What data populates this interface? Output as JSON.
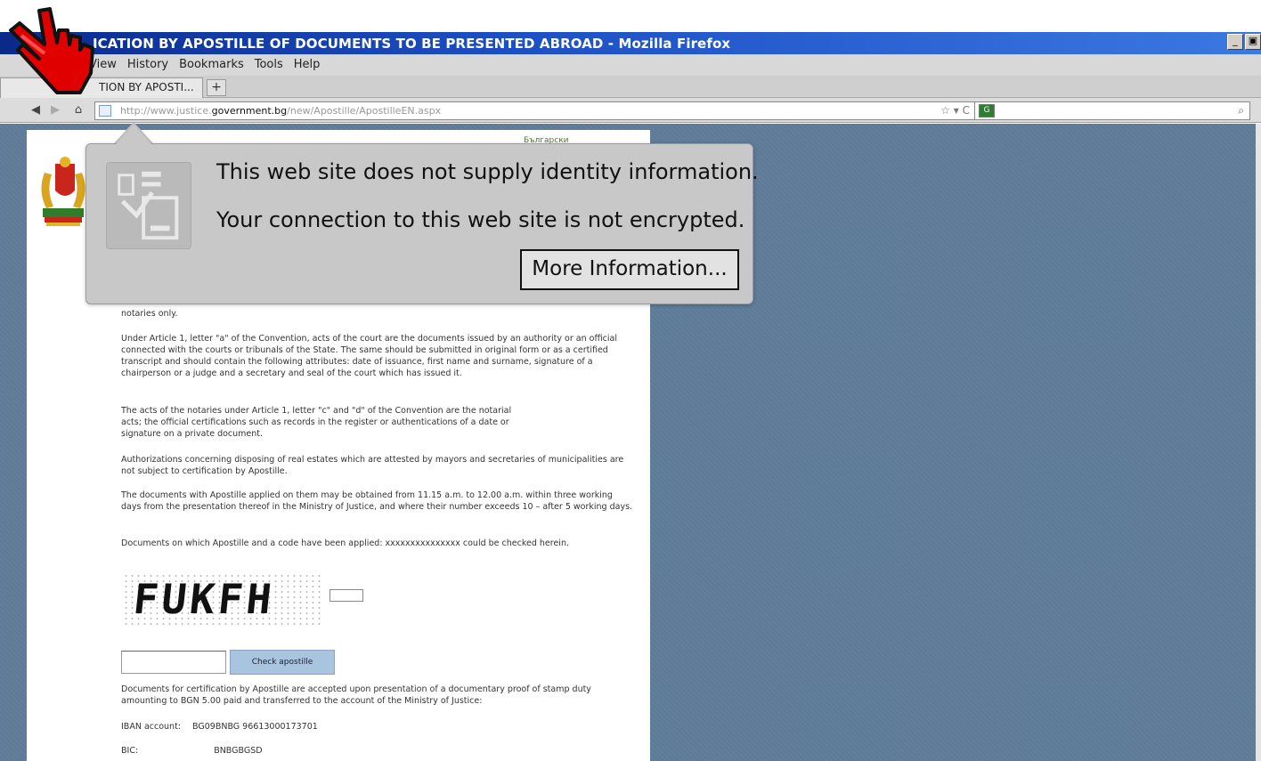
{
  "window": {
    "title": "ICATION BY APOSTILLE OF DOCUMENTS TO BE PRESENTED ABROAD - Mozilla Firefox",
    "minimize": "_",
    "restore": "▣"
  },
  "menubar": {
    "items": [
      "View",
      "History",
      "Bookmarks",
      "Tools",
      "Help"
    ]
  },
  "tabs": [
    {
      "label": "TION BY APOSTI..."
    }
  ],
  "newtab_label": "+",
  "navbar": {
    "url_prefix": "http://www.justice.",
    "url_domain": "government.bg",
    "url_suffix": "/new/Apostille/ApostilleEN.aspx",
    "url_right": "☆ ▾ C"
  },
  "page": {
    "lang_link": "Български",
    "para0": "notaries only.",
    "para1": "Under Article 1, letter \"a\" of the Convention, acts of the court are the documents issued by an authority or an official connected with the courts or tribunals of the State. The same should be submitted in original form or as a certified transcript and should contain the following attributes: date of issuance, first name and surname, signature of a chairperson or a judge and a secretary and seal of the court which has issued it.",
    "para2": "The acts of the notaries under Article 1, letter \"c\" and \"d\" of the Convention are the notarial acts; the official certifications such as records in the register or authentications of a date or signature on a private document.",
    "para3": "Authorizations concerning disposing of real estates which are attested by mayors and secretaries of municipalities are not subject to certification by Apostille.",
    "para4": "The documents with Apostille applied on them may be obtained from 11.15 a.m. to 12.00 a.m. within three working days from the presentation thereof in the Ministry of Justice, and where their number exceeds 10 – after 5 working days.",
    "para5": "Documents on which Apostille and a code have been applied: xxxxxxxxxxxxxxx could be checked herein.",
    "captcha_text": "FUKFH",
    "check_button": "Check apostille",
    "para6": "Documents for certification by Apostille are accepted upon presentation of a documentary proof of stamp duty amounting to BGN 5.00 paid and transferred to the account of the Ministry of Justice:",
    "iban_label": "IBAN account:",
    "iban_value": "BG09BNBG 96613000173701",
    "bic_label": "BIC:",
    "bic_value": "BNBGBGSD"
  },
  "identity_popup": {
    "line1": "This web site does not supply identity information.",
    "line2": "Your connection to this web site is not encrypted.",
    "button": "More Information..."
  },
  "colors": {
    "titlebar": "#1c4fc4",
    "page_background": "#5f7c99",
    "popup_background": "#c8c8c8",
    "cursor_red": "#e00000"
  }
}
